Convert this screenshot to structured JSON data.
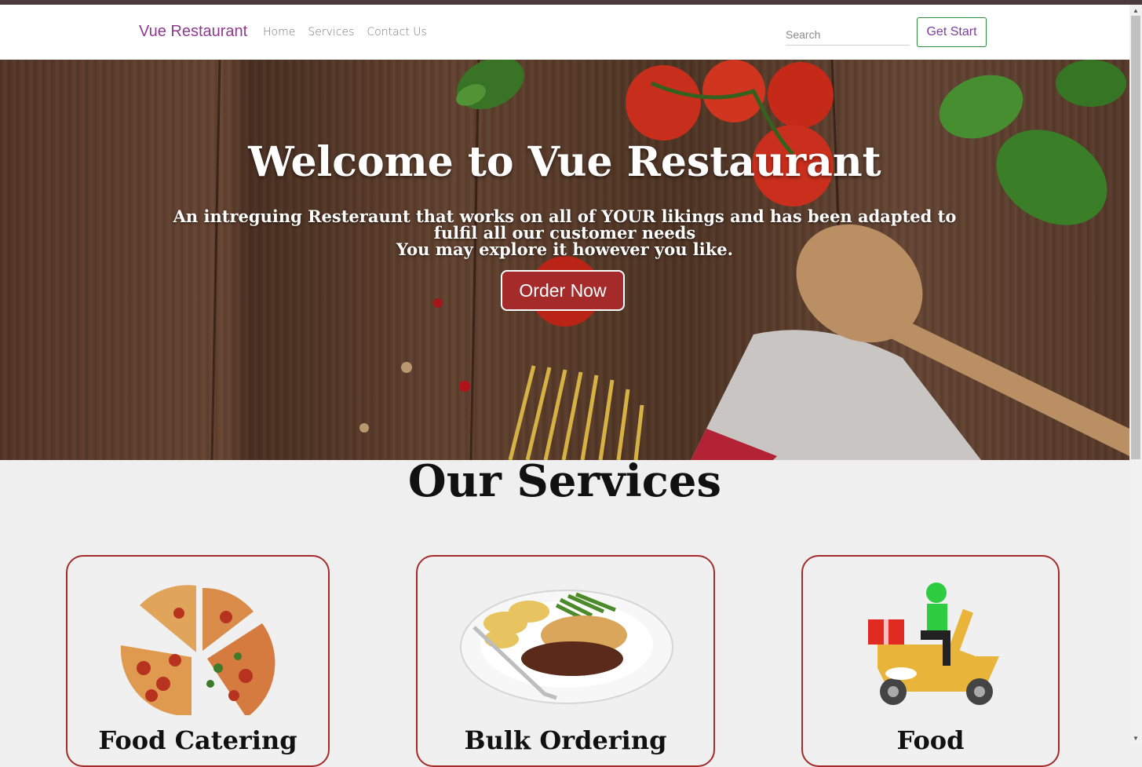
{
  "navbar": {
    "brand": "Vue Restaurant",
    "links": [
      "Home",
      "Services",
      "Contact Us"
    ],
    "search_placeholder": "Search",
    "get_start_label": "Get Start"
  },
  "hero": {
    "title": "Welcome to Vue Restaurant",
    "subtitle_line1": "An intreguing Resteraunt that works on all of YOUR likings and has been adapted to fulfil all our customer needs",
    "subtitle_line2": "You may explore it however you like.",
    "order_button": "Order Now"
  },
  "services": {
    "title": "Our Services",
    "cards": [
      {
        "title": "Food Catering",
        "image": "pizza-image"
      },
      {
        "title": "Bulk Ordering",
        "image": "plated-meal-image"
      },
      {
        "title": "Food",
        "image": "delivery-scooter-image"
      }
    ]
  },
  "colors": {
    "brand": "#8e3b8e",
    "accent_red": "#a52a2a",
    "get_start_border": "#2e8b3e"
  }
}
